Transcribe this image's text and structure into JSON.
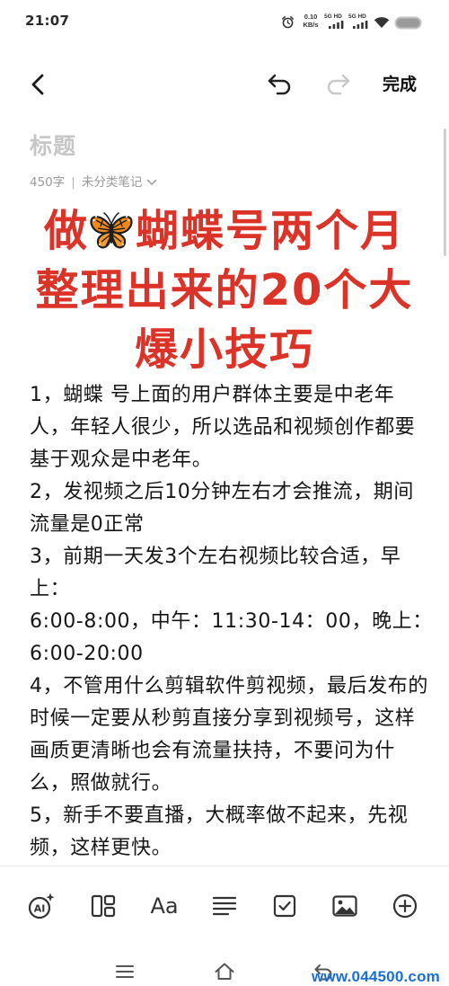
{
  "status_bar": {
    "time": "21:07",
    "alarm_icon": "alarm-icon",
    "net_speed": {
      "value": "0.10",
      "unit": "KB/s"
    },
    "sim1": {
      "label": "5G HD",
      "icon": "signal-bars-icon"
    },
    "sim2": {
      "label": "5G HD",
      "icon": "signal-bars-icon"
    },
    "wifi_icon": "wifi-icon",
    "battery_icon": "battery-icon"
  },
  "toolbar": {
    "back_icon": "chevron-left-icon",
    "undo_icon": "undo-icon",
    "redo_icon": "redo-icon",
    "redo_enabled": false,
    "done_label": "完成"
  },
  "note": {
    "title_placeholder": "标题",
    "word_count": "450字",
    "meta_separator": "|",
    "category": "未分类笔记",
    "category_icon": "chevron-down-icon",
    "heading": {
      "color": "#dc3328",
      "line1_prefix": "做",
      "line1_emoji_icon": "butterfly-icon",
      "line1_suffix": "蝴蝶号两个月",
      "line2": "整理出来的20个大",
      "line3": "爆小技巧"
    },
    "body_lines": [
      "1，蝴蝶 号上面的用户群体主要是中老年",
      "人，年轻人很少，所以选品和视频创作都要",
      "基于观众是中老年。",
      "2，发视频之后10分钟左右才会推流，期间",
      "流量是0正常",
      "3，前期一天发3个左右视频比较合适，早",
      "上：",
      "6:00-8:00，中午：11:30-14：00，晚上：",
      "6:00-20:00",
      "4，不管用什么剪辑软件剪视频，最后发布的",
      "时候一定要从秒剪直接分享到视频号，这样",
      "画质更清晰也会有流量扶持，不要问为什",
      "么，照做就行。",
      "5，新手不要直播，大概率做不起来，先视",
      "频，这样更快。"
    ]
  },
  "format_toolbar": {
    "ai_label": "AI",
    "text_style_label": "Aa",
    "icons": [
      "ai-assistant-icon",
      "template-icon",
      "text-style-icon",
      "paragraph-align-icon",
      "checklist-icon",
      "image-icon",
      "add-circle-icon"
    ]
  },
  "nav_bar": {
    "icons": [
      "menu-icon",
      "home-icon",
      "back-icon"
    ]
  },
  "watermark": {
    "text": "www.044500.com",
    "color": "#1c6fd1"
  }
}
